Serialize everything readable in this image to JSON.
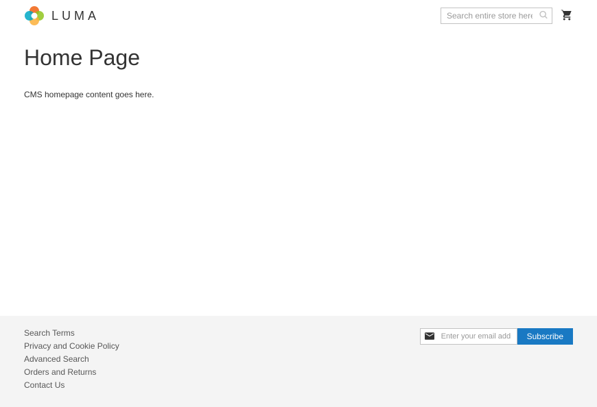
{
  "header": {
    "logo_text": "LUMA",
    "search_placeholder": "Search entire store here..."
  },
  "main": {
    "page_title": "Home Page",
    "cms_content": "CMS homepage content goes here."
  },
  "footer": {
    "links": [
      "Search Terms",
      "Privacy and Cookie Policy",
      "Advanced Search",
      "Orders and Returns",
      "Contact Us"
    ],
    "newsletter_placeholder": "Enter your email address",
    "subscribe_label": "Subscribe"
  }
}
